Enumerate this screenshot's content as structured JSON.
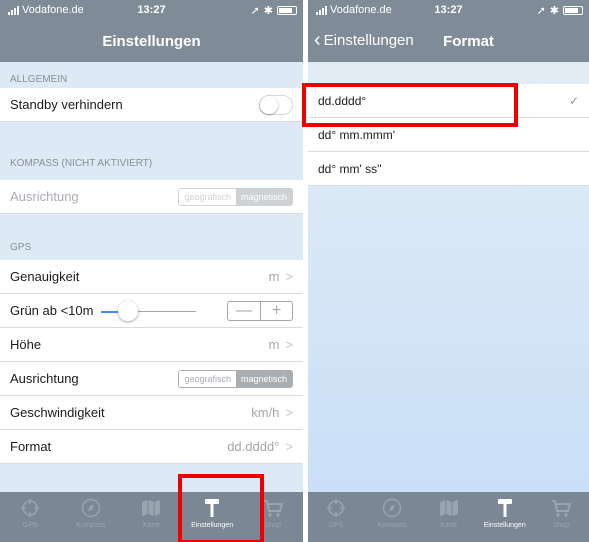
{
  "left": {
    "status": {
      "carrier": "Vodafone.de",
      "time": "13:27"
    },
    "nav_title": "Einstellungen",
    "sections": {
      "allgemein": "ALLGEMEIN",
      "kompass": "KOMPASS (NICHT AKTIVIERT)",
      "gps": "GPS"
    },
    "rows": {
      "standby": {
        "label": "Standby verhindern",
        "toggle_on": false
      },
      "kompass_ausrichtung": {
        "label": "Ausrichtung",
        "options": [
          "geografisch",
          "magnetisch"
        ],
        "selected": "magnetisch"
      },
      "genauigkeit": {
        "label": "Genauigkeit",
        "value": "m"
      },
      "gruen": {
        "label": "Grün ab <10m",
        "slider_fraction": 0.22,
        "minus": "—",
        "plus": "+"
      },
      "hoehe": {
        "label": "Höhe",
        "value": "m"
      },
      "gps_ausrichtung": {
        "label": "Ausrichtung",
        "options": [
          "geografisch",
          "magnetisch"
        ],
        "selected": "magnetisch"
      },
      "geschwindigkeit": {
        "label": "Geschwindigkeit",
        "value": "km/h"
      },
      "format": {
        "label": "Format",
        "value": "dd.dddd°"
      }
    }
  },
  "right": {
    "status": {
      "carrier": "Vodafone.de",
      "time": "13:27"
    },
    "back_label": "Einstellungen",
    "nav_title": "Format",
    "options": [
      "dd.dddd°",
      "dd° mm.mmm'",
      "dd° mm' ss''"
    ],
    "selected_index": 0
  },
  "tabs": [
    "GPS",
    "Kompass",
    "Karte",
    "Einstellungen",
    "Shop"
  ],
  "active_tab": "Einstellungen",
  "colors": {
    "highlight": "#ee0000",
    "accent": "#3f8ef7",
    "bar": "#7f8c98"
  }
}
